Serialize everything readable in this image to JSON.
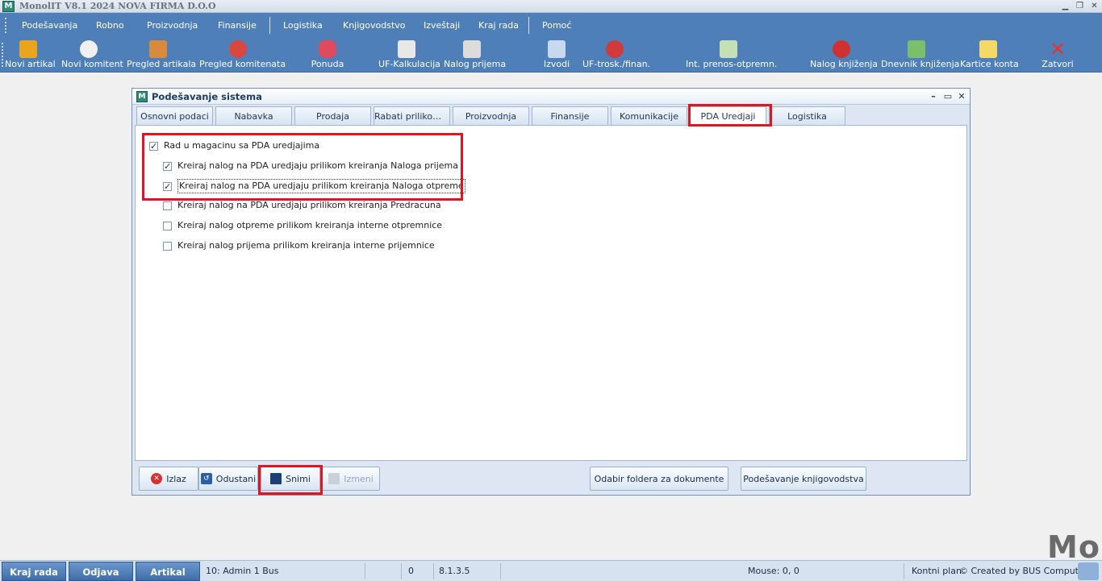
{
  "window": {
    "title": "MonolIT V8.1 2024 NOVA FIRMA D.O.O",
    "app_icon_letter": "M"
  },
  "menu": [
    "Podešavanja",
    "Robno",
    "Proizvodnja",
    "Finansije",
    "Logistika",
    "Knjigovodstvo",
    "Izveštaji",
    "Kraj rada",
    "Pomoć"
  ],
  "toolbar": [
    {
      "label": "Novi artikal",
      "icon": "shopping-bag-icon",
      "color": "#e9a420"
    },
    {
      "label": "Novi komitent",
      "icon": "user-add-icon",
      "color": "#f0f0f0"
    },
    {
      "label": "Pregled artikala",
      "icon": "items-search-icon",
      "color": "#d68c3a"
    },
    {
      "label": "Pregled komitenata",
      "icon": "clients-globe-icon",
      "color": "#d9473f"
    },
    {
      "label": "Ponuda",
      "icon": "offer-icon",
      "color": "#e04a5e"
    },
    {
      "label": "UF-Kalkulacija",
      "icon": "calculation-sheet-icon",
      "color": "#e8e8e8"
    },
    {
      "label": "Nalog prijema",
      "icon": "receipt-order-icon",
      "color": "#dcdcdc"
    },
    {
      "label": "Izvodi",
      "icon": "statements-icon",
      "color": "#c8d8ee"
    },
    {
      "label": "UF-trosk./finan.",
      "icon": "cost-invoice-icon",
      "color": "#d03a3a"
    },
    {
      "label": "Int. prenos-otpremn.",
      "icon": "internal-transfer-icon",
      "color": "#c5e0b4"
    },
    {
      "label": "Nalog knjiženja",
      "icon": "booking-order-icon",
      "color": "#cf3030"
    },
    {
      "label": "Dnevnik knjiženja",
      "icon": "journal-books-icon",
      "color": "#7cbf6a"
    },
    {
      "label": "Kartice konta",
      "icon": "account-cards-icon",
      "color": "#f3d86a"
    },
    {
      "label": "Zatvori",
      "icon": "close-x-icon",
      "color": "#e8322c"
    }
  ],
  "dialog": {
    "title": "Podešavanje sistema",
    "tabs": [
      "Osnovni podaci",
      "Nabavka",
      "Prodaja",
      "Rabati prilikom p...",
      "Proizvodnja",
      "Finansije",
      "Komunikacije",
      "PDA Uredjaji",
      "Logistika"
    ],
    "active_tab": "PDA Uredjaji",
    "options": [
      {
        "label": "Rad u magacinu sa PDA uredjajima",
        "checked": true
      },
      {
        "label": "Kreiraj nalog na PDA uredjaju prilikom kreiranja Naloga prijema",
        "checked": true
      },
      {
        "label": "Kreiraj nalog na PDA uredjaju prilikom kreiranja Naloga otpreme",
        "checked": true
      },
      {
        "label": "Kreiraj nalog na PDA uredjaju prilikom kreiranja Predracuna",
        "checked": false
      },
      {
        "label": "Kreiraj nalog otpreme prilikom kreiranja interne otpremnice",
        "checked": false
      },
      {
        "label": "Kreiraj nalog prijema prilikom kreiranja interne prijemnice",
        "checked": false
      }
    ],
    "buttons": {
      "izlaz": "Izlaz",
      "odustani": "Odustani",
      "snimi": "Snimi",
      "izmeni": "Izmeni",
      "odabir": "Odabir foldera za dokumente",
      "knjigovodstvo": "Podešavanje knjigovodstva"
    }
  },
  "statusbar": {
    "kraj_rada": "Kraj rada",
    "odjava": "Odjava",
    "artikal": "Artikal",
    "user": "10: Admin 1 Bus",
    "count": "0",
    "version": "8.1.3.5",
    "mouse": "Mouse: 0, 0",
    "kontni_plan": "Kontni plan",
    "created_by": "© Created by BUS Computer"
  },
  "watermark": "Mo",
  "colors": {
    "accent": "#4f7fb8",
    "highlight": "#e0151f"
  }
}
